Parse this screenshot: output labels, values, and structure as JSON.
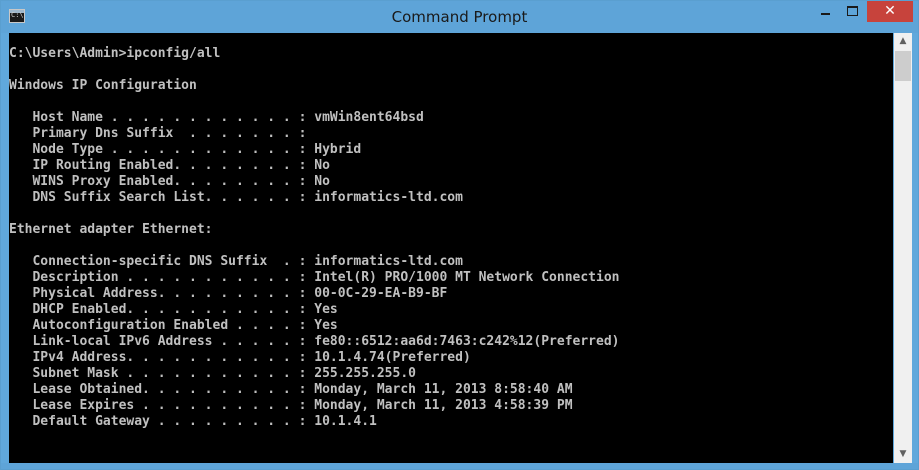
{
  "window": {
    "title": "Command Prompt",
    "icon_label": "C:\\",
    "icon": "console-icon",
    "controls": {
      "minimize_icon": "minimize-icon",
      "maximize_icon": "maximize-icon",
      "close_icon": "close-icon",
      "close_glyph": "✕"
    },
    "accent_color": "#5ea4d8",
    "close_color": "#c7433c"
  },
  "console": {
    "background": "#000000",
    "text_color": "#c0c0c0",
    "lines": [
      "C:\\Users\\Admin>ipconfig/all",
      "",
      "Windows IP Configuration",
      "",
      "   Host Name . . . . . . . . . . . . : vmWin8ent64bsd",
      "   Primary Dns Suffix  . . . . . . . :",
      "   Node Type . . . . . . . . . . . . : Hybrid",
      "   IP Routing Enabled. . . . . . . . : No",
      "   WINS Proxy Enabled. . . . . . . . : No",
      "   DNS Suffix Search List. . . . . . : informatics-ltd.com",
      "",
      "Ethernet adapter Ethernet:",
      "",
      "   Connection-specific DNS Suffix  . : informatics-ltd.com",
      "   Description . . . . . . . . . . . : Intel(R) PRO/1000 MT Network Connection",
      "   Physical Address. . . . . . . . . : 00-0C-29-EA-B9-BF",
      "   DHCP Enabled. . . . . . . . . . . : Yes",
      "   Autoconfiguration Enabled . . . . : Yes",
      "   Link-local IPv6 Address . . . . . : fe80::6512:aa6d:7463:c242%12(Preferred)",
      "   IPv4 Address. . . . . . . . . . . : 10.1.4.74(Preferred)",
      "   Subnet Mask . . . . . . . . . . . : 255.255.255.0",
      "   Lease Obtained. . . . . . . . . . : Monday, March 11, 2013 8:58:40 AM",
      "   Lease Expires . . . . . . . . . . : Monday, March 11, 2013 4:58:39 PM",
      "   Default Gateway . . . . . . . . . : 10.1.4.1"
    ]
  },
  "scrollbar": {
    "up_arrow": "▲",
    "down_arrow": "▼",
    "up_icon": "scroll-up-arrow-icon",
    "down_icon": "scroll-down-arrow-icon"
  }
}
